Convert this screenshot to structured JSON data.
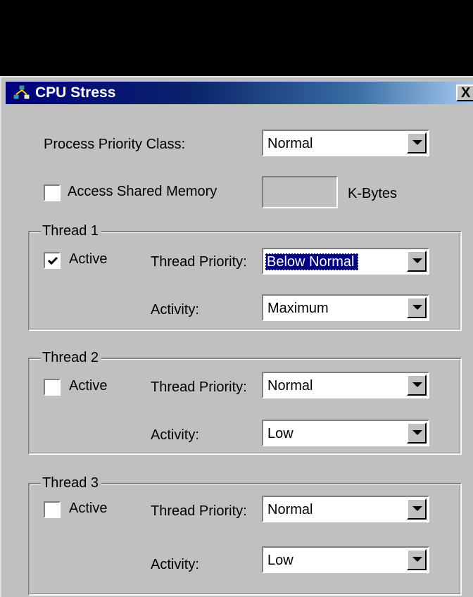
{
  "window": {
    "title": "CPU Stress",
    "app_icon": "cpu-stress-icon",
    "close_label": "X"
  },
  "process": {
    "priority_label": "Process Priority Class:",
    "priority_value": "Normal",
    "shared_memory_label": "Access Shared Memory",
    "shared_memory_checked": false,
    "shared_memory_value": "",
    "kbytes_label": "K-Bytes"
  },
  "threads": [
    {
      "title": "Thread 1",
      "active_label": "Active",
      "active": true,
      "priority_label": "Thread Priority:",
      "priority_value": "Below Normal",
      "activity_label": "Activity:",
      "activity_value": "Maximum"
    },
    {
      "title": "Thread 2",
      "active_label": "Active",
      "active": false,
      "priority_label": "Thread Priority:",
      "priority_value": "Normal",
      "activity_label": "Activity:",
      "activity_value": "Low"
    },
    {
      "title": "Thread 3",
      "active_label": "Active",
      "active": false,
      "priority_label": "Thread Priority:",
      "priority_value": "Normal",
      "activity_label": "Activity:",
      "activity_value": "Low"
    }
  ],
  "colors": {
    "face": "#c0c0c0",
    "title_start": "#000080",
    "title_end": "#a6caf0",
    "selection": "#000080"
  }
}
